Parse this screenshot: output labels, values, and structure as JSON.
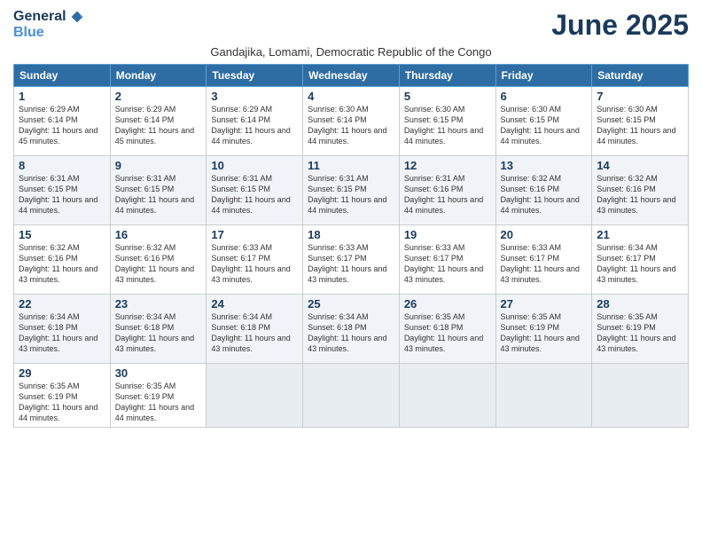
{
  "header": {
    "logo_line1": "General",
    "logo_line2": "Blue",
    "month": "June 2025",
    "subtitle": "Gandajika, Lomami, Democratic Republic of the Congo"
  },
  "weekdays": [
    "Sunday",
    "Monday",
    "Tuesday",
    "Wednesday",
    "Thursday",
    "Friday",
    "Saturday"
  ],
  "weeks": [
    [
      {
        "day": "1",
        "sunrise": "6:29 AM",
        "sunset": "6:14 PM",
        "daylight": "11 hours and 45 minutes."
      },
      {
        "day": "2",
        "sunrise": "6:29 AM",
        "sunset": "6:14 PM",
        "daylight": "11 hours and 45 minutes."
      },
      {
        "day": "3",
        "sunrise": "6:29 AM",
        "sunset": "6:14 PM",
        "daylight": "11 hours and 44 minutes."
      },
      {
        "day": "4",
        "sunrise": "6:30 AM",
        "sunset": "6:14 PM",
        "daylight": "11 hours and 44 minutes."
      },
      {
        "day": "5",
        "sunrise": "6:30 AM",
        "sunset": "6:15 PM",
        "daylight": "11 hours and 44 minutes."
      },
      {
        "day": "6",
        "sunrise": "6:30 AM",
        "sunset": "6:15 PM",
        "daylight": "11 hours and 44 minutes."
      },
      {
        "day": "7",
        "sunrise": "6:30 AM",
        "sunset": "6:15 PM",
        "daylight": "11 hours and 44 minutes."
      }
    ],
    [
      {
        "day": "8",
        "sunrise": "6:31 AM",
        "sunset": "6:15 PM",
        "daylight": "11 hours and 44 minutes."
      },
      {
        "day": "9",
        "sunrise": "6:31 AM",
        "sunset": "6:15 PM",
        "daylight": "11 hours and 44 minutes."
      },
      {
        "day": "10",
        "sunrise": "6:31 AM",
        "sunset": "6:15 PM",
        "daylight": "11 hours and 44 minutes."
      },
      {
        "day": "11",
        "sunrise": "6:31 AM",
        "sunset": "6:15 PM",
        "daylight": "11 hours and 44 minutes."
      },
      {
        "day": "12",
        "sunrise": "6:31 AM",
        "sunset": "6:16 PM",
        "daylight": "11 hours and 44 minutes."
      },
      {
        "day": "13",
        "sunrise": "6:32 AM",
        "sunset": "6:16 PM",
        "daylight": "11 hours and 44 minutes."
      },
      {
        "day": "14",
        "sunrise": "6:32 AM",
        "sunset": "6:16 PM",
        "daylight": "11 hours and 43 minutes."
      }
    ],
    [
      {
        "day": "15",
        "sunrise": "6:32 AM",
        "sunset": "6:16 PM",
        "daylight": "11 hours and 43 minutes."
      },
      {
        "day": "16",
        "sunrise": "6:32 AM",
        "sunset": "6:16 PM",
        "daylight": "11 hours and 43 minutes."
      },
      {
        "day": "17",
        "sunrise": "6:33 AM",
        "sunset": "6:17 PM",
        "daylight": "11 hours and 43 minutes."
      },
      {
        "day": "18",
        "sunrise": "6:33 AM",
        "sunset": "6:17 PM",
        "daylight": "11 hours and 43 minutes."
      },
      {
        "day": "19",
        "sunrise": "6:33 AM",
        "sunset": "6:17 PM",
        "daylight": "11 hours and 43 minutes."
      },
      {
        "day": "20",
        "sunrise": "6:33 AM",
        "sunset": "6:17 PM",
        "daylight": "11 hours and 43 minutes."
      },
      {
        "day": "21",
        "sunrise": "6:34 AM",
        "sunset": "6:17 PM",
        "daylight": "11 hours and 43 minutes."
      }
    ],
    [
      {
        "day": "22",
        "sunrise": "6:34 AM",
        "sunset": "6:18 PM",
        "daylight": "11 hours and 43 minutes."
      },
      {
        "day": "23",
        "sunrise": "6:34 AM",
        "sunset": "6:18 PM",
        "daylight": "11 hours and 43 minutes."
      },
      {
        "day": "24",
        "sunrise": "6:34 AM",
        "sunset": "6:18 PM",
        "daylight": "11 hours and 43 minutes."
      },
      {
        "day": "25",
        "sunrise": "6:34 AM",
        "sunset": "6:18 PM",
        "daylight": "11 hours and 43 minutes."
      },
      {
        "day": "26",
        "sunrise": "6:35 AM",
        "sunset": "6:18 PM",
        "daylight": "11 hours and 43 minutes."
      },
      {
        "day": "27",
        "sunrise": "6:35 AM",
        "sunset": "6:19 PM",
        "daylight": "11 hours and 43 minutes."
      },
      {
        "day": "28",
        "sunrise": "6:35 AM",
        "sunset": "6:19 PM",
        "daylight": "11 hours and 43 minutes."
      }
    ],
    [
      {
        "day": "29",
        "sunrise": "6:35 AM",
        "sunset": "6:19 PM",
        "daylight": "11 hours and 44 minutes."
      },
      {
        "day": "30",
        "sunrise": "6:35 AM",
        "sunset": "6:19 PM",
        "daylight": "11 hours and 44 minutes."
      },
      null,
      null,
      null,
      null,
      null
    ]
  ]
}
